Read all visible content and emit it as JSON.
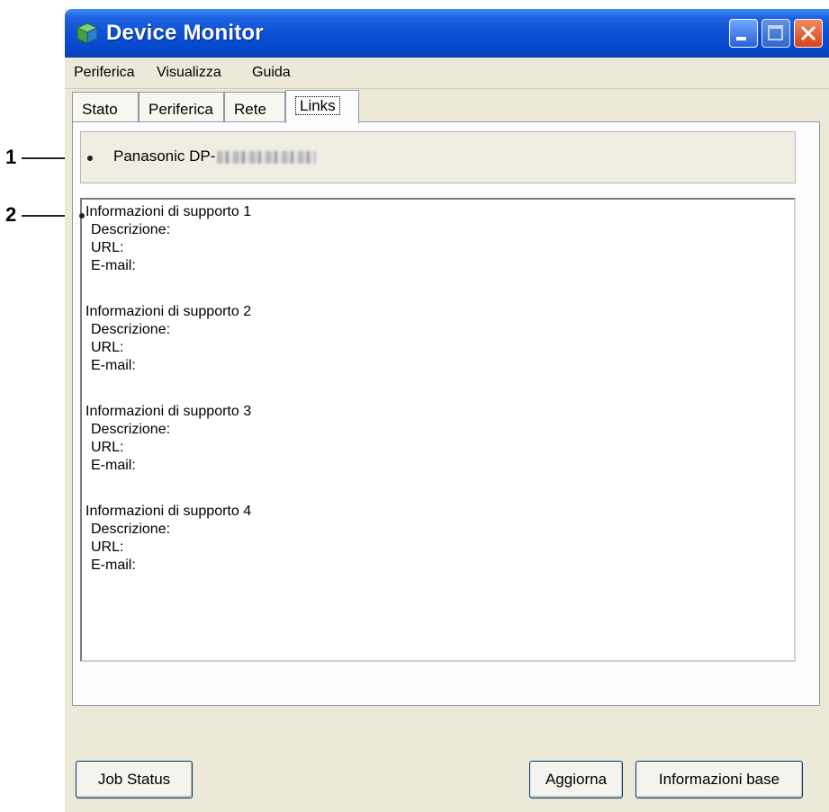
{
  "callouts": [
    "1",
    "2"
  ],
  "window": {
    "title": "Device Monitor",
    "controls": [
      "minimize-icon",
      "maximize-icon",
      "close-icon"
    ]
  },
  "menu": [
    {
      "label": "Periferica"
    },
    {
      "label": "Visualizza"
    },
    {
      "label": "Guida"
    }
  ],
  "tabs": [
    {
      "label": "Stato"
    },
    {
      "label": "Periferica"
    },
    {
      "label": "Rete"
    },
    {
      "label": "Links",
      "active": true
    }
  ],
  "device": {
    "name": "Panasonic DP-"
  },
  "support": [
    {
      "title": "Informazioni di supporto 1",
      "description": "Descrizione:",
      "url": "URL:",
      "email": "E-mail:"
    },
    {
      "title": "Informazioni di supporto 2",
      "description": "Descrizione:",
      "url": "URL:",
      "email": "E-mail:"
    },
    {
      "title": "Informazioni di supporto 3",
      "description": "Descrizione:",
      "url": "URL:",
      "email": "E-mail:"
    },
    {
      "title": "Informazioni di supporto 4",
      "description": "Descrizione:",
      "url": "URL:",
      "email": "E-mail:"
    }
  ],
  "buttons": {
    "job_status": "Job Status",
    "refresh": "Aggiorna",
    "basic_info": "Informazioni base"
  },
  "colors": {
    "titlebar": "#0a4fd4",
    "window_bg": "#ece9d8",
    "button_border": "#003c74"
  }
}
